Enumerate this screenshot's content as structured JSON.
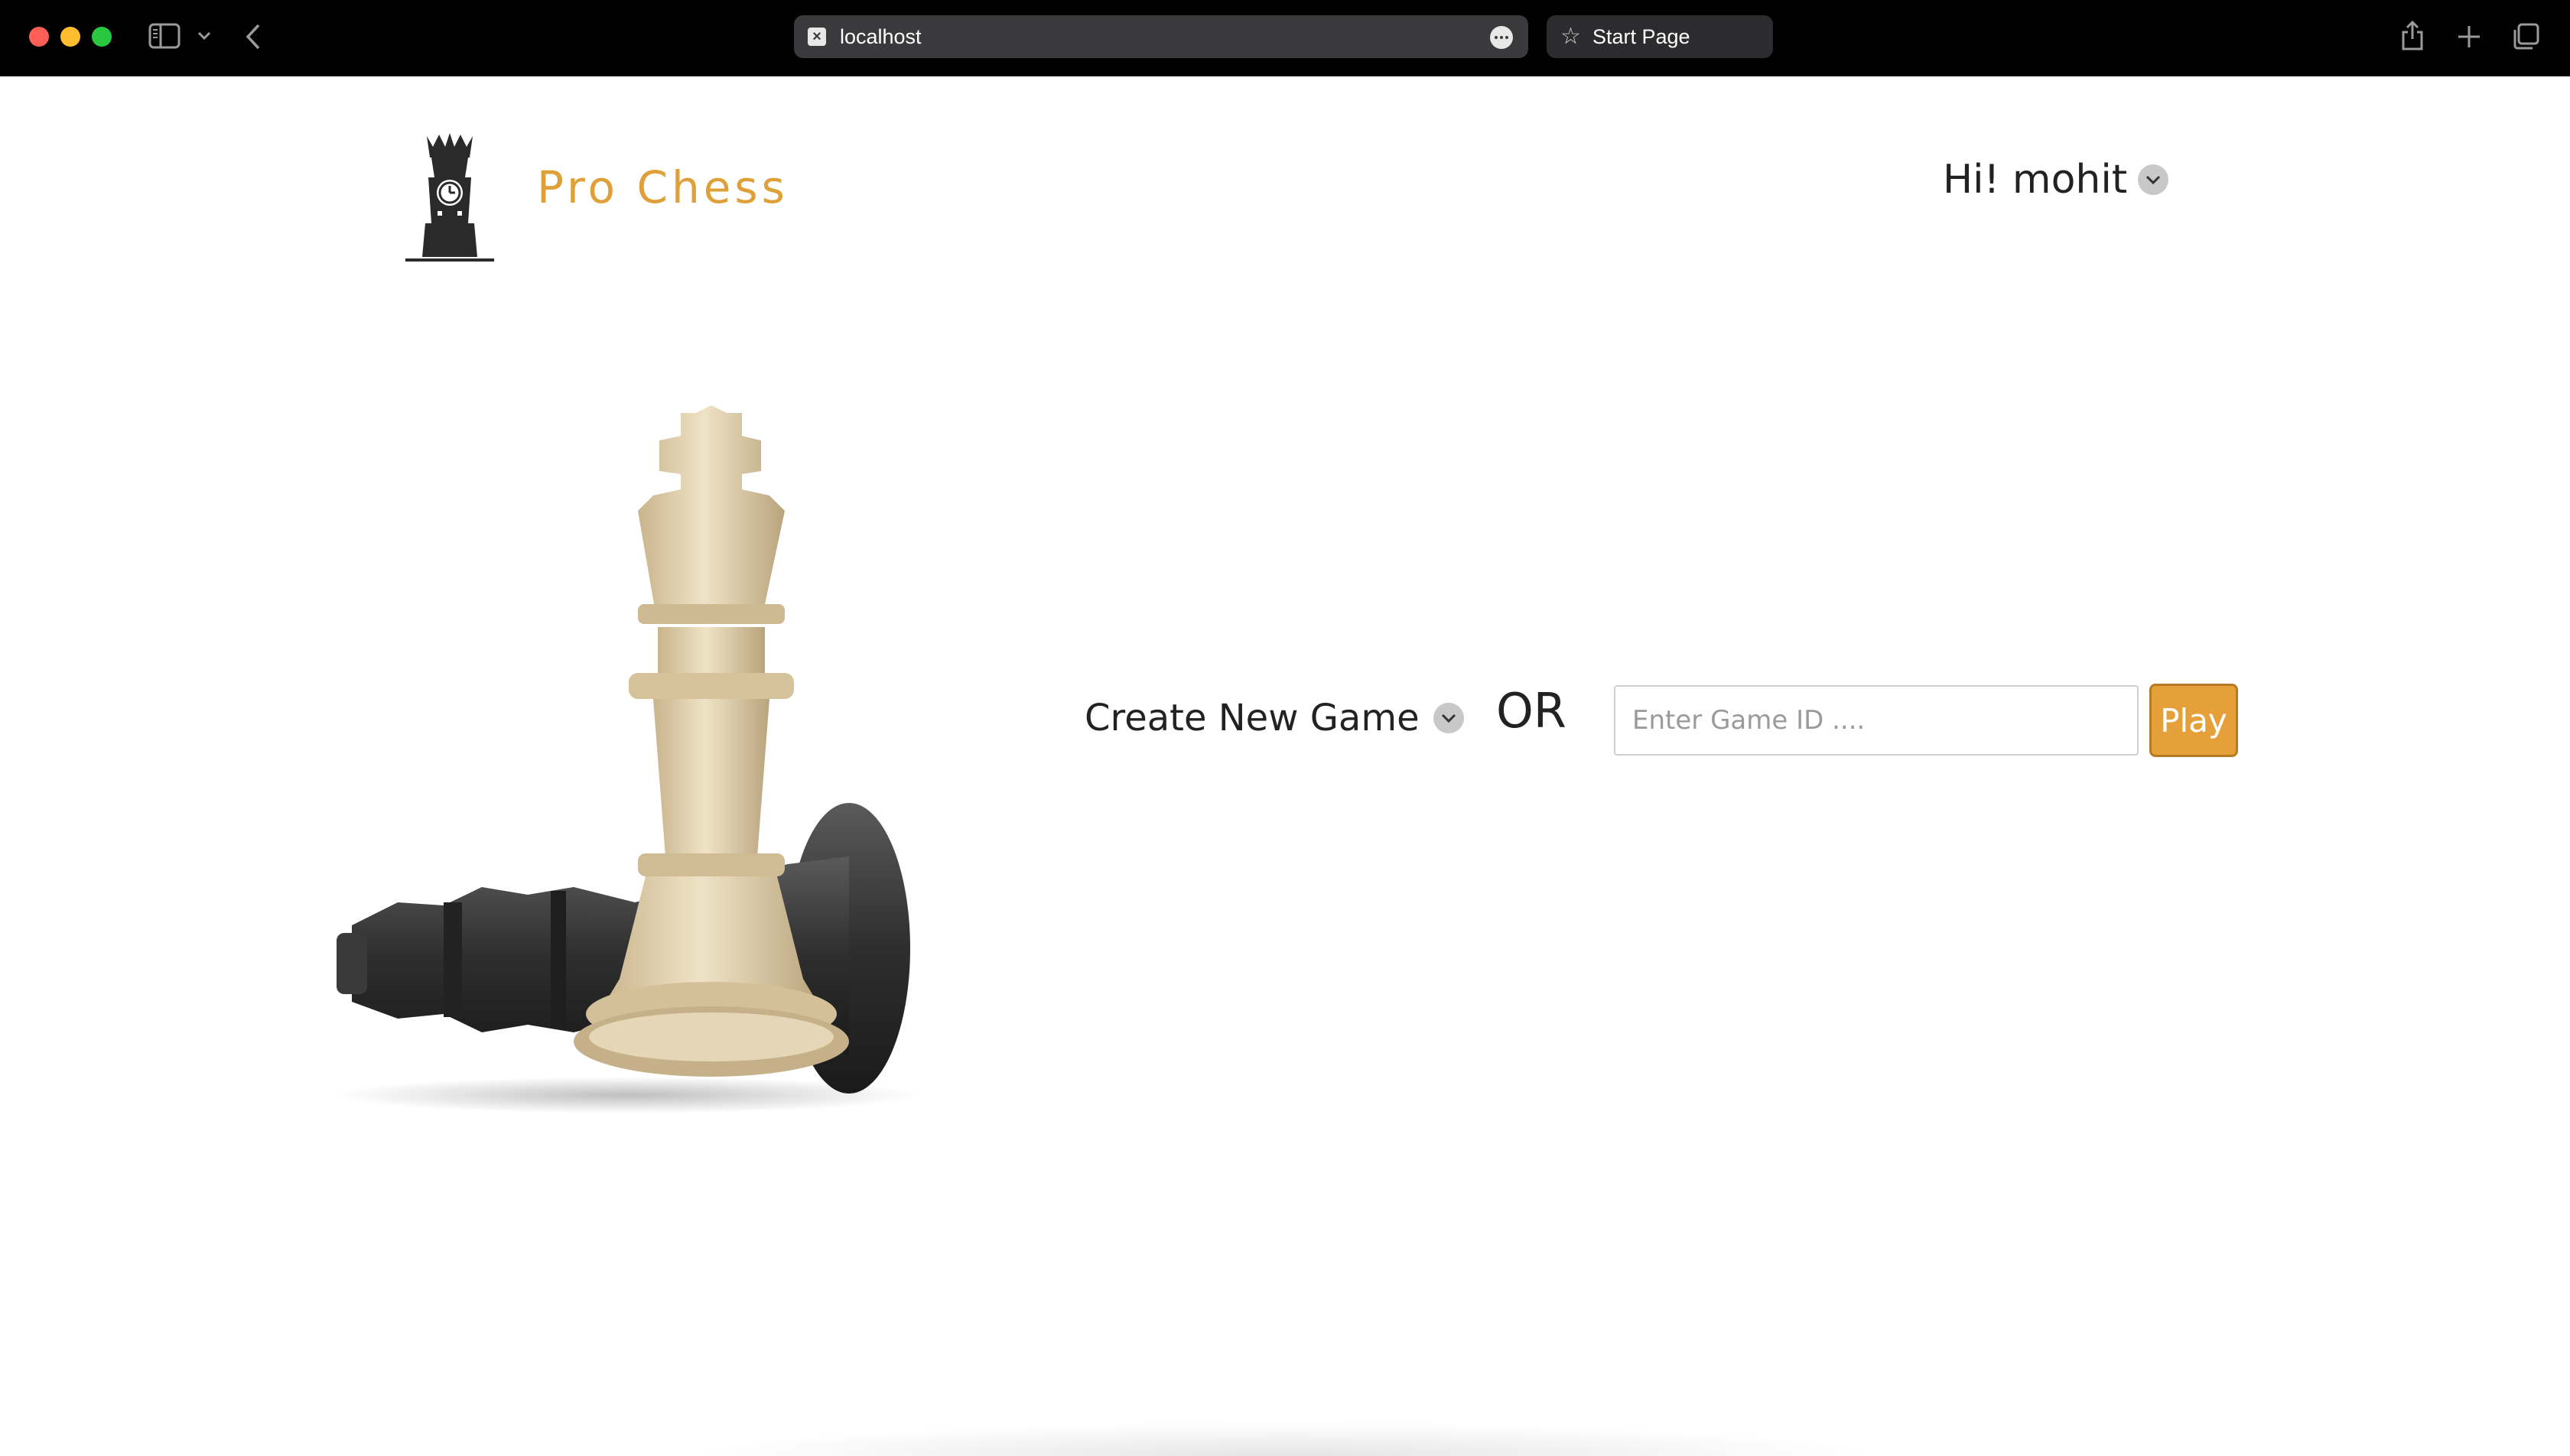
{
  "browser": {
    "address": "localhost",
    "start_tab": "Start Page"
  },
  "header": {
    "brand": "Pro Chess",
    "user_greeting": "Hi! mohit"
  },
  "main": {
    "create_game_label": "Create New Game",
    "or_text": "OR",
    "game_id_placeholder": "Enter Game ID ....",
    "game_id_value": "",
    "play_label": "Play"
  },
  "colors": {
    "brand": "#e0a038",
    "play_button": "#e6a03a",
    "chrome": "#000000"
  },
  "icons": {
    "logo": "rook-clock-logo-icon",
    "hero": "chess-king-and-fallen-king-image",
    "user_menu": "chevron-down-icon",
    "create_game_menu": "chevron-down-icon"
  }
}
